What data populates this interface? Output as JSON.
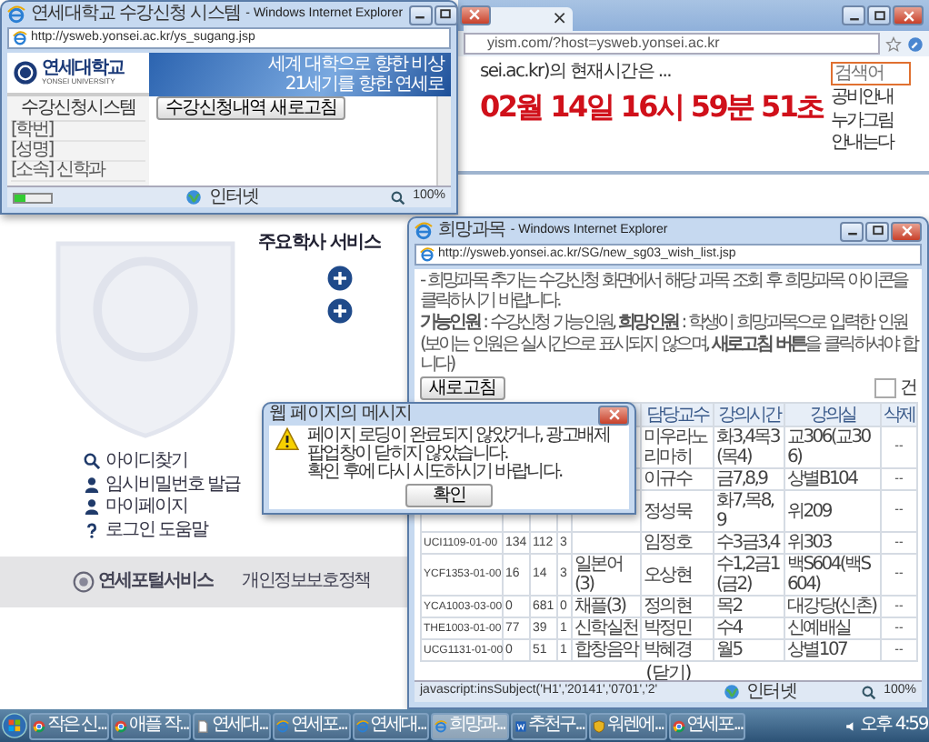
{
  "browser_back": {
    "tab_close": "×",
    "address": "yism.com/?host=ysweb.yonsei.ac.kr",
    "caption": "sei.ac.kr)의 현재시간은 ...",
    "clock": "02월 14일 16시 59분 51초",
    "search": {
      "placeholder": "검색어"
    },
    "side_links": [
      "공비안내",
      "누가그림",
      "안내는다"
    ]
  },
  "portal": {
    "section_title": "주요학사 서비스",
    "links": [
      {
        "kind": "search",
        "label": "아이디찾기"
      },
      {
        "kind": "person",
        "label": "임시비밀번호 발급"
      },
      {
        "kind": "person",
        "label": "마이페이지"
      },
      {
        "kind": "help",
        "label": "로그인 도움말"
      }
    ],
    "footer_logo": "연세포털서비스",
    "footer_link": "개인정보보호정책"
  },
  "sugang_window": {
    "title": "연세대학교 수강신청 시스템",
    "app": "- Windows Internet Explorer",
    "address": "http://ysweb.yonsei.ac.kr/ys_sugang.jsp",
    "logo": "연세대학교",
    "logo_sub": "YONSEI UNIVERSITY",
    "banner": [
      "세계 대학으로 향한 비상",
      "21세기를 향한 연세로"
    ],
    "system_title": "수강신청시스템",
    "info": [
      "[학번]",
      "[성명]",
      "[소속] 신학과"
    ],
    "refresh_button": "수강신청내역 새로고침",
    "status": {
      "level": 0.3,
      "zone": "인터넷",
      "zoom": "100%"
    }
  },
  "wish_window": {
    "title": "희망과목",
    "app": "- Windows Internet Explorer",
    "address": "http://ysweb.yonsei.ac.kr/SG/new_sg03_wish_list.jsp",
    "notes": [
      "- 희망과목 추가는 수강신청 화면에서 해당 과목 조회 후 희망과목 아이콘을 클릭하시기 바랍니다.",
      "**가능인원** : 수강신청 가능인원, **희망인원** : 학생이 희망과목으로 입력한 인원",
      "(보이는 인원은 실시간으로 표시되지 않으며, **새로고침 버튼**을 클릭하셔야 합니다)"
    ],
    "refresh_button": "새로고침",
    "count_unit": "건",
    "columns": [
      "담당교수",
      "강의시간",
      "강의실",
      "삭제"
    ],
    "rows": [
      {
        "prof": "미우라노리마히",
        "time": "화3,4목3(목4)",
        "room": "교306(교306)",
        "del": "--"
      },
      {
        "prof": "이규수",
        "time": "금7,8,9",
        "room": "상별B104",
        "del": "--"
      },
      {
        "prof": "정성묵",
        "time": "화7,목8,9",
        "room": "위209",
        "del": "--"
      },
      {
        "code": "UCI1109-01-00",
        "cap": "134",
        "applied": "112",
        "credit": "3",
        "prof": "임정호",
        "time": "수3금3,4",
        "room": "위303",
        "del": "--"
      },
      {
        "code": "YCF1353-01-00",
        "cap": "16",
        "applied": "14",
        "credit": "3",
        "course": "일본어(3)",
        "prof": "오상현",
        "time": "수1,2금1(금2)",
        "room": "백S604(백S604)",
        "del": "--"
      },
      {
        "code": "YCA1003-03-00",
        "cap": "0",
        "applied": "681",
        "credit": "0",
        "course": "채플(3)",
        "prof": "정의현",
        "time": "목2",
        "room": "대강당(신촌)",
        "del": "--"
      },
      {
        "code": "THE1003-01-00",
        "cap": "77",
        "applied": "39",
        "credit": "1",
        "course": "신학실천",
        "prof": "박정민",
        "time": "수4",
        "room": "신예배실",
        "del": "--"
      },
      {
        "code": "UCG1131-01-00",
        "cap": "0",
        "applied": "51",
        "credit": "1",
        "course": "합창음악",
        "prof": "박혜경",
        "time": "월5",
        "room": "상별107",
        "del": "--"
      }
    ],
    "close_link": "(닫기)",
    "status": {
      "text": "javascript:insSubject('H1','20141','0701','2'",
      "zone": "인터넷",
      "zoom": "100%"
    }
  },
  "dialog": {
    "title": "웹 페이지의 메시지",
    "lines": [
      "페이지 로딩이 완료되지 않았거나, 광고배제 팝업창이 닫히지 않았습니다.",
      "확인 후에 다시 시도하시기 바랍니다."
    ],
    "ok_button": "확인"
  },
  "taskbar": {
    "items": [
      {
        "kind": "chrome",
        "label": "작은 신...",
        "selected": false
      },
      {
        "kind": "chrome",
        "label": "애플 작...",
        "selected": false
      },
      {
        "kind": "page",
        "label": "연세대...",
        "selected": false
      },
      {
        "kind": "ie",
        "label": "연세포...",
        "selected": false
      },
      {
        "kind": "ie",
        "label": "연세대...",
        "selected": false
      },
      {
        "kind": "ie",
        "label": "희망과...",
        "selected": true
      },
      {
        "kind": "square",
        "label": "추천구...",
        "selected": false
      },
      {
        "kind": "shield",
        "label": "워렌에...",
        "selected": false
      },
      {
        "kind": "chrome",
        "label": "연세포...",
        "selected": false
      }
    ],
    "clock": "오후 4:59"
  }
}
